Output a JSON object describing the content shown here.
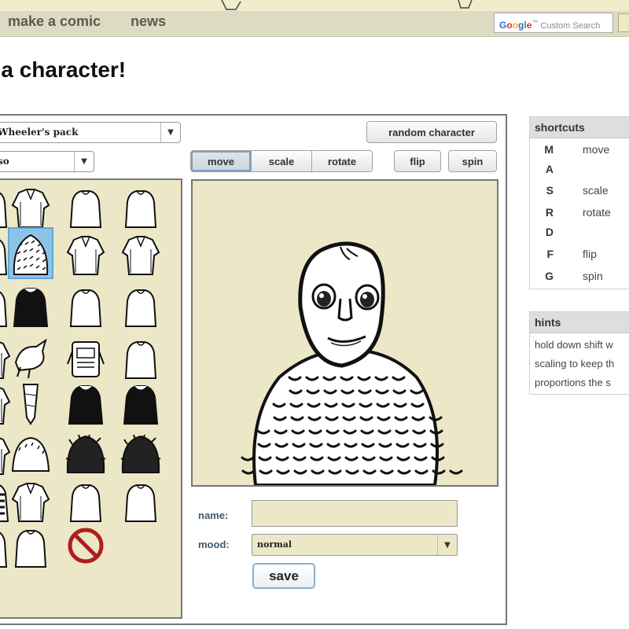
{
  "header": {
    "nav": [
      "make a comic",
      "news"
    ],
    "search": {
      "logo": "Google",
      "tm": "™",
      "placeholder": "Custom Search"
    }
  },
  "page": {
    "title": "e a character!"
  },
  "editor": {
    "pack_select": "Wheeler's pack",
    "category_select": "so",
    "random_button": "random character",
    "tools": [
      "move",
      "scale",
      "rotate"
    ],
    "active_tool": "move",
    "flip_button": "flip",
    "spin_button": "spin",
    "form": {
      "name_label": "name:",
      "name_value": "",
      "mood_label": "mood:",
      "mood_value": "normal",
      "save_button": "save"
    },
    "palette_items": [
      "torso-1",
      "torso-2",
      "torso-3",
      "torso-4",
      "torso-5",
      "torso-6-selected",
      "torso-7",
      "torso-8",
      "torso-9",
      "torso-10",
      "torso-11",
      "torso-12",
      "torso-13",
      "torso-14",
      "torso-15",
      "torso-16",
      "torso-17",
      "torso-18",
      "torso-19",
      "torso-20",
      "torso-21",
      "torso-22",
      "torso-23",
      "torso-24",
      "torso-25",
      "torso-26",
      "torso-27",
      "torso-28",
      "torso-29",
      "torso-30",
      "none-icon"
    ]
  },
  "shortcuts": {
    "title": "shortcuts",
    "items": [
      {
        "key": "M",
        "action": "move"
      },
      {
        "key": "A",
        "action": ""
      },
      {
        "key": "S",
        "action": "scale"
      },
      {
        "key": "R",
        "action": "rotate"
      },
      {
        "key": "D",
        "action": ""
      },
      {
        "key": "F",
        "action": "flip"
      },
      {
        "key": "G",
        "action": "spin"
      }
    ]
  },
  "hints": {
    "title": "hints",
    "lines": [
      "hold down shift w",
      "scaling to keep th",
      "proportions the s"
    ]
  },
  "colors": {
    "parchment": "#ece7c6",
    "navbar": "#dedbc4",
    "selection": "#8cc4e8",
    "no_symbol": "#b01c1c"
  }
}
